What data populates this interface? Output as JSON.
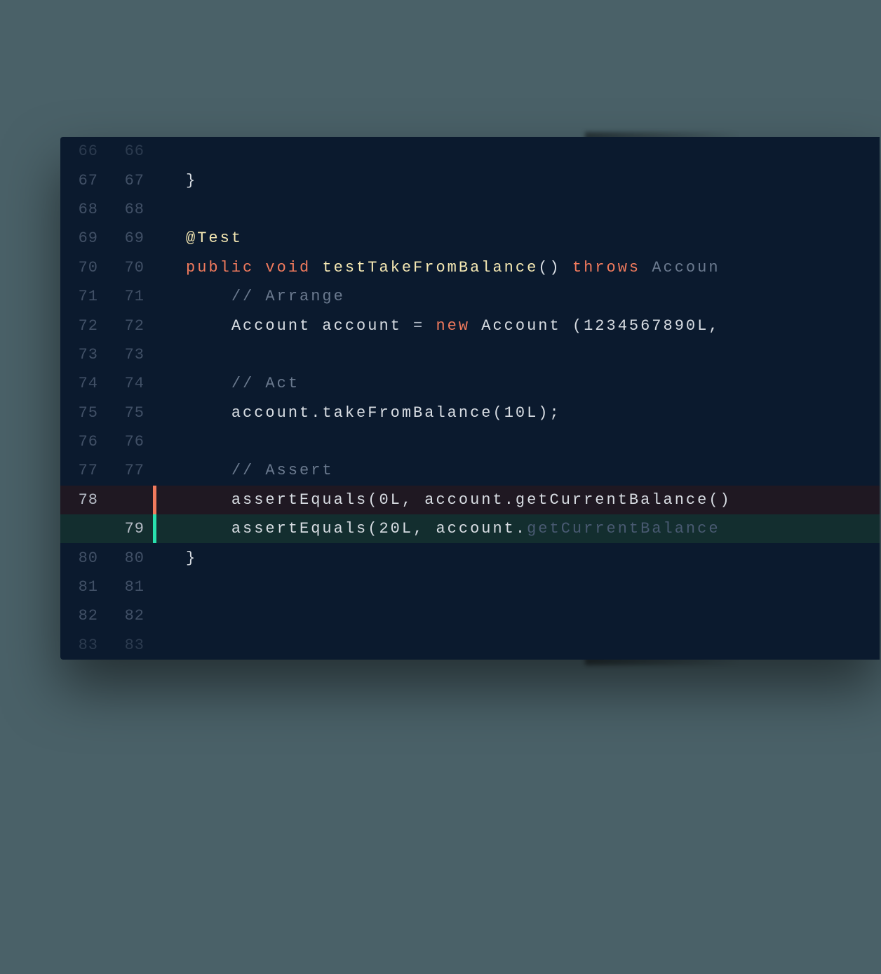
{
  "colors": {
    "bg_page": "#4a6168",
    "bg_editor": "#0b1a2e",
    "gutter_text": "#415066",
    "removed_bar": "#f07a5d",
    "added_bar": "#29e0ae",
    "removed_bg": "#1f1822",
    "added_bg": "#132e2f",
    "keyword": "#f07a5d",
    "annotation": "#f5e8b3",
    "comment": "#6b7a8f"
  },
  "lines": [
    {
      "old": "66",
      "new": "66",
      "faded": true,
      "tokens": [
        {
          "t": "",
          "c": "tok-ident"
        }
      ]
    },
    {
      "old": "67",
      "new": "67",
      "tokens": [
        {
          "t": "}",
          "c": "tok-brace"
        }
      ]
    },
    {
      "old": "68",
      "new": "68",
      "tokens": []
    },
    {
      "old": "69",
      "new": "69",
      "tokens": [
        {
          "t": "@Test",
          "c": "tok-anno"
        }
      ]
    },
    {
      "old": "70",
      "new": "70",
      "tokens": [
        {
          "t": "public ",
          "c": "tok-kw"
        },
        {
          "t": "void ",
          "c": "tok-kw2"
        },
        {
          "t": "testTakeFromBalance",
          "c": "tok-method"
        },
        {
          "t": "() ",
          "c": "tok-punc"
        },
        {
          "t": "throws ",
          "c": "tok-throws"
        },
        {
          "t": "Accoun",
          "c": "tok-exc"
        }
      ]
    },
    {
      "old": "71",
      "new": "71",
      "indent": 1,
      "tokens": [
        {
          "t": "// Arrange",
          "c": "tok-comment"
        }
      ]
    },
    {
      "old": "72",
      "new": "72",
      "indent": 1,
      "tokens": [
        {
          "t": "Account account ",
          "c": "tok-type"
        },
        {
          "t": "= ",
          "c": "tok-op"
        },
        {
          "t": "new ",
          "c": "tok-kw"
        },
        {
          "t": "Account ",
          "c": "tok-type"
        },
        {
          "t": "(",
          "c": "tok-punc"
        },
        {
          "t": "1234567890L",
          "c": "tok-num"
        },
        {
          "t": ",",
          "c": "tok-punc"
        }
      ]
    },
    {
      "old": "73",
      "new": "73",
      "tokens": []
    },
    {
      "old": "74",
      "new": "74",
      "indent": 1,
      "tokens": [
        {
          "t": "// Act",
          "c": "tok-comment"
        }
      ]
    },
    {
      "old": "75",
      "new": "75",
      "indent": 1,
      "tokens": [
        {
          "t": "account",
          "c": "tok-ident"
        },
        {
          "t": ".",
          "c": "tok-punc"
        },
        {
          "t": "takeFromBalance",
          "c": "tok-ident"
        },
        {
          "t": "(",
          "c": "tok-punc"
        },
        {
          "t": "10L",
          "c": "tok-num"
        },
        {
          "t": ");",
          "c": "tok-punc"
        }
      ]
    },
    {
      "old": "76",
      "new": "76",
      "tokens": []
    },
    {
      "old": "77",
      "new": "77",
      "indent": 1,
      "tokens": [
        {
          "t": "// Assert",
          "c": "tok-comment"
        }
      ]
    },
    {
      "old": "78",
      "new": "",
      "kind": "removed",
      "indent": 1,
      "tokens": [
        {
          "t": "assertEquals",
          "c": "tok-ident"
        },
        {
          "t": "(",
          "c": "tok-punc"
        },
        {
          "t": "0L",
          "c": "tok-num"
        },
        {
          "t": ", account",
          "c": "tok-ident"
        },
        {
          "t": ".",
          "c": "tok-punc"
        },
        {
          "t": "getCurrentBalance",
          "c": "tok-ident"
        },
        {
          "t": "()",
          "c": "tok-punc"
        }
      ]
    },
    {
      "old": "",
      "new": "79",
      "kind": "added",
      "indent": 1,
      "tokens": [
        {
          "t": "assertEquals",
          "c": "tok-ident"
        },
        {
          "t": "(",
          "c": "tok-punc"
        },
        {
          "t": "20L",
          "c": "tok-num"
        },
        {
          "t": ", account",
          "c": "tok-ident"
        },
        {
          "t": ".",
          "c": "tok-punc"
        },
        {
          "t": "getCurrentBalance",
          "c": "tok-ident text-faded"
        }
      ]
    },
    {
      "old": "80",
      "new": "80",
      "tokens": [
        {
          "t": "}",
          "c": "tok-brace"
        }
      ]
    },
    {
      "old": "81",
      "new": "81",
      "tokens": []
    },
    {
      "old": "82",
      "new": "82",
      "tokens": []
    },
    {
      "old": "83",
      "new": "83",
      "faded": true,
      "tokens": []
    }
  ]
}
